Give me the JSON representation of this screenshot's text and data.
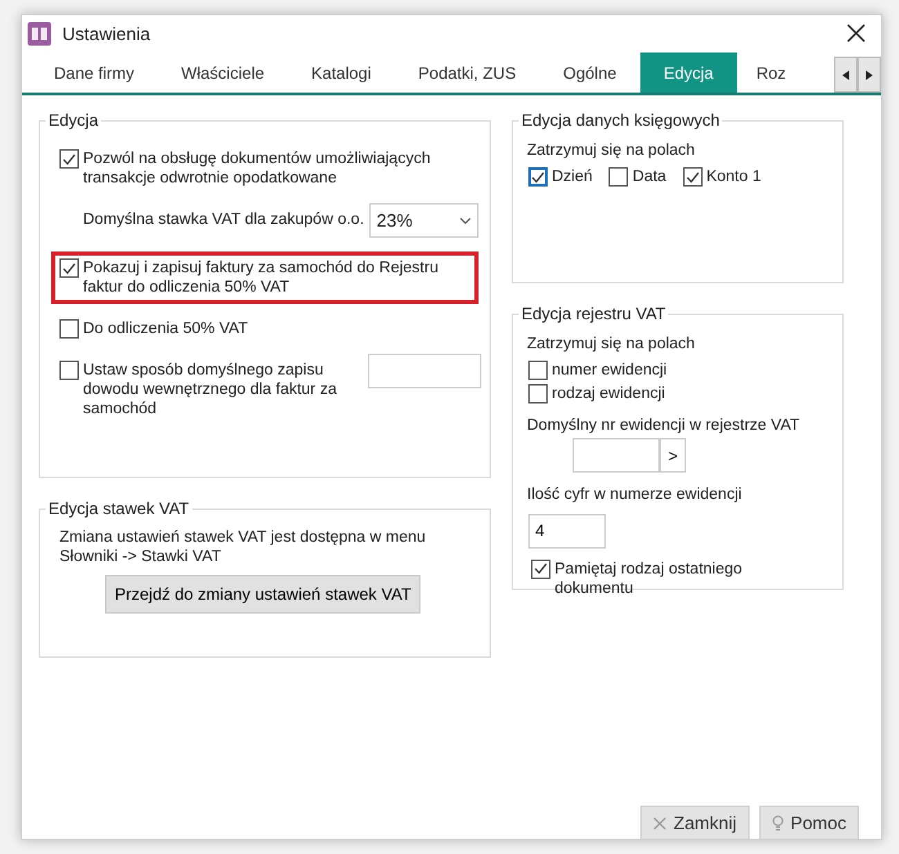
{
  "window": {
    "title": "Ustawienia"
  },
  "tabs": [
    {
      "label": "Dane firmy",
      "selected": false
    },
    {
      "label": "Właściciele",
      "selected": false
    },
    {
      "label": "Katalogi",
      "selected": false
    },
    {
      "label": "Podatki, ZUS",
      "selected": false
    },
    {
      "label": "Ogólne",
      "selected": false
    },
    {
      "label": "Edycja",
      "selected": true
    },
    {
      "label": "Roz",
      "selected": false
    }
  ],
  "edycja": {
    "title": "Edycja",
    "items": [
      {
        "kind": "checkbox",
        "label": "Pozwól na obsługę dokumentów umożliwiających transakcje odwrotnie opodatkowane",
        "checked": true,
        "highlighted": false
      },
      {
        "kind": "select",
        "label": "Domyślna stawka VAT dla zakupów o.o.",
        "value": "23%"
      },
      {
        "kind": "checkbox",
        "label": "Pokazuj i zapisuj faktury za samochód do Rejestru faktur  do odliczenia 50% VAT",
        "checked": true,
        "highlighted": true
      },
      {
        "kind": "checkbox",
        "label": "Do odliczenia 50% VAT",
        "checked": false,
        "highlighted": false
      },
      {
        "kind": "checkbox_field",
        "label": "Ustaw sposób domyślnego zapisu dowodu wewnętrznego dla faktur za samochód",
        "checked": false,
        "highlighted": false
      }
    ]
  },
  "stawki": {
    "title": "Edycja stawek VAT",
    "text": "Zmiana ustawień stawek VAT jest dostępna  w menu Słowniki -> Stawki VAT",
    "button": "Przejdź do zmiany ustawień stawek VAT"
  },
  "ksiegowe": {
    "title": "Edycja danych księgowych",
    "label": "Zatrzymuj się na polach",
    "fields": [
      {
        "label": "Dzień",
        "checked": true,
        "focused": true
      },
      {
        "label": "Data",
        "checked": false,
        "focused": false
      },
      {
        "label": "Konto 1",
        "checked": true,
        "focused": false
      }
    ]
  },
  "rejestr": {
    "title": "Edycja rejestru VAT",
    "label": "Zatrzymuj się na polach",
    "fields": [
      {
        "label": "numer ewidencji",
        "checked": false
      },
      {
        "label": "rodzaj ewidencji",
        "checked": false
      }
    ],
    "default_number_label": "Domyślny nr ewidencji w rejestrze VAT",
    "browse_button": ">",
    "digits_label": "Ilość cyfr w numerze ewidencji",
    "digits_value": "4",
    "remember": {
      "label": "Pamiętaj rodzaj ostatniego dokumentu",
      "checked": true
    }
  },
  "buttons": [
    {
      "kind": "close",
      "label": "Zamknij"
    },
    {
      "kind": "help",
      "label": "Pomoc"
    }
  ]
}
